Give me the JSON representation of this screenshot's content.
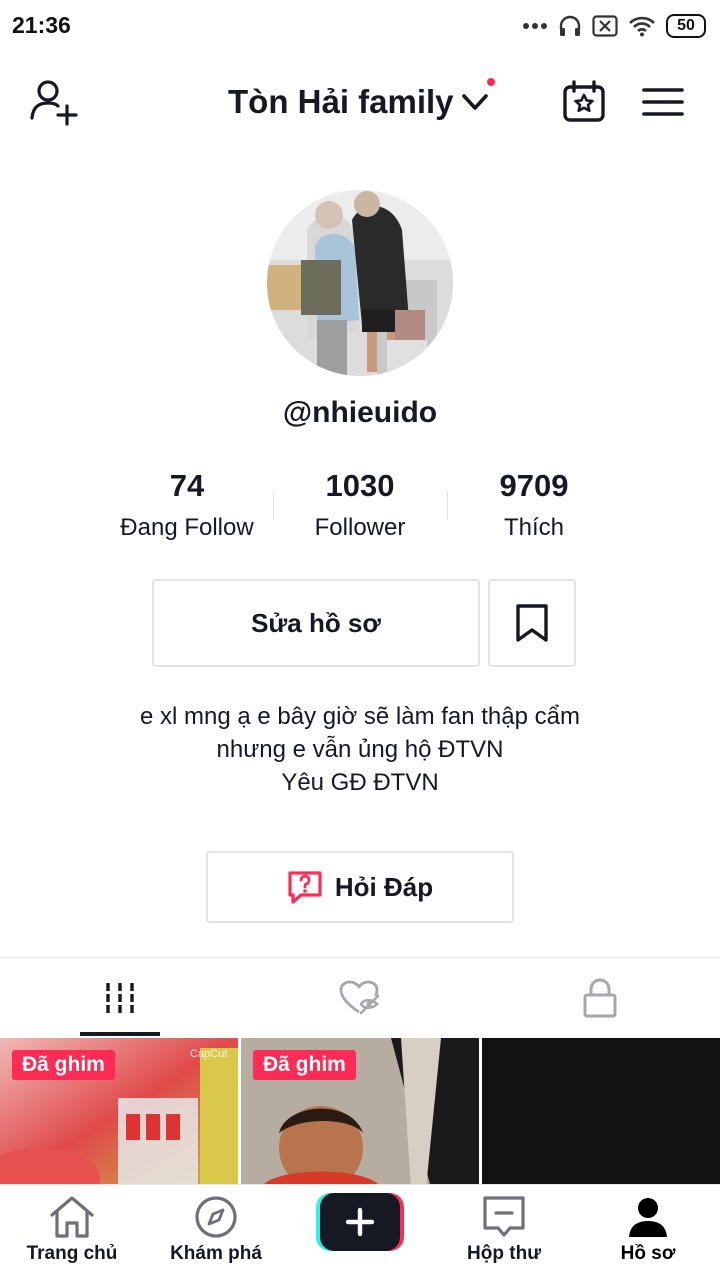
{
  "status_bar": {
    "time": "21:36",
    "battery": "50"
  },
  "header": {
    "title": "Tòn Hải family"
  },
  "profile": {
    "username": "@nhieuido",
    "stats": [
      {
        "value": "74",
        "label": "Đang Follow"
      },
      {
        "value": "1030",
        "label": "Follower"
      },
      {
        "value": "9709",
        "label": "Thích"
      }
    ],
    "edit_label": "Sửa hồ sơ",
    "bio": [
      "e xl mng ạ e bây giờ sẽ làm fan thập cẩm",
      "nhưng e vẫn ủng hộ ĐTVN",
      "Yêu GĐ ĐTVN"
    ],
    "qa_label": "Hỏi Đáp"
  },
  "videos": [
    {
      "badge": "Đã ghim",
      "watermark": "CapCut"
    },
    {
      "badge": "Đã ghim"
    },
    {}
  ],
  "bottom_nav": [
    {
      "label": "Trang chủ",
      "icon": "home-icon"
    },
    {
      "label": "Khám phá",
      "icon": "compass-icon"
    },
    {
      "label": "",
      "icon": "plus-icon"
    },
    {
      "label": "Hộp thư",
      "icon": "inbox-icon"
    },
    {
      "label": "Hồ sơ",
      "icon": "profile-icon"
    }
  ],
  "colors": {
    "accent": "#fe2c55",
    "text": "#161823",
    "cyan": "#25f4ee"
  }
}
